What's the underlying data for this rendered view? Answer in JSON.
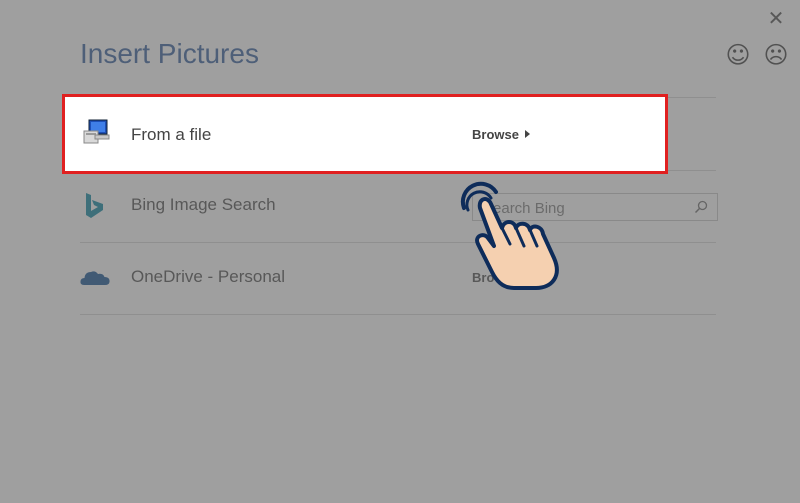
{
  "window": {
    "title": "Insert Pictures",
    "close_glyph": "✕",
    "smile_glyph": "☺",
    "frown_glyph": "☹"
  },
  "sources": [
    {
      "label": "From a file",
      "action": "Browse",
      "icon": "computer-icon"
    },
    {
      "label": "Bing Image Search",
      "placeholder": "Search Bing",
      "icon": "bing-logo-icon"
    },
    {
      "label": "OneDrive - Personal",
      "action": "Browse",
      "icon": "onedrive-cloud-icon"
    }
  ],
  "colors": {
    "title": "#2b579a",
    "highlight_border": "#e02020",
    "bing": "#00809d",
    "onedrive": "#0a4a8f",
    "hand_fill": "#f5d0b0",
    "hand_outline": "#0e2c5a"
  }
}
